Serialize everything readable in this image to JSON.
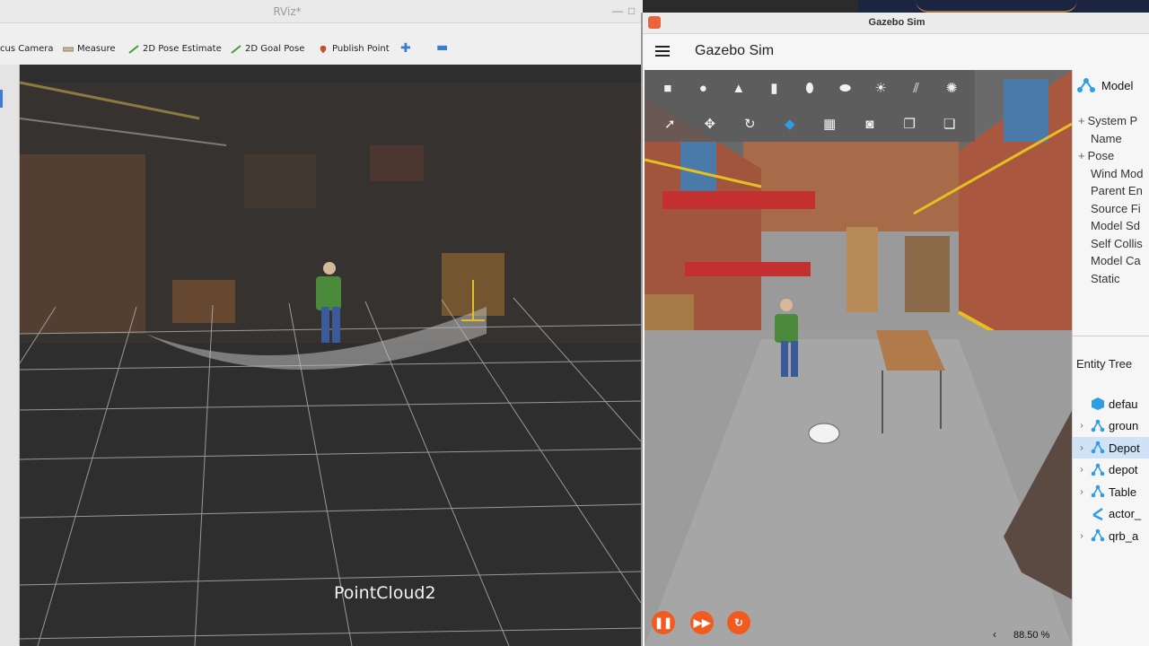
{
  "rviz": {
    "title": "RViz*",
    "toolbar": {
      "focus_camera": "cus Camera",
      "measure": "Measure",
      "pose_estimate": "2D Pose Estimate",
      "goal_pose": "2D Goal Pose",
      "publish_point": "Publish Point"
    },
    "view_label": "PointCloud2"
  },
  "gazebo": {
    "window_title": "Gazebo Sim",
    "app_title": "Gazebo Sim",
    "component": {
      "header": "Model",
      "rows": [
        {
          "label": "System P",
          "expandable": true
        },
        {
          "label": "Name",
          "expandable": false
        },
        {
          "label": "Pose",
          "expandable": true
        },
        {
          "label": "Wind Mod",
          "expandable": false
        },
        {
          "label": "Parent En",
          "expandable": false
        },
        {
          "label": "Source Fi",
          "expandable": false
        },
        {
          "label": "Model Sd",
          "expandable": false
        },
        {
          "label": "Self Collis",
          "expandable": false
        },
        {
          "label": "Model Ca",
          "expandable": false
        },
        {
          "label": "Static",
          "expandable": false
        }
      ]
    },
    "entity_tree": {
      "header": "Entity Tree",
      "items": [
        {
          "label": "defau",
          "icon": "cube-icon",
          "selected": false,
          "expandable": false
        },
        {
          "label": "groun",
          "icon": "model-icon",
          "selected": false,
          "expandable": true
        },
        {
          "label": "Depot",
          "icon": "model-icon",
          "selected": true,
          "expandable": true
        },
        {
          "label": "depot",
          "icon": "model-icon",
          "selected": false,
          "expandable": true
        },
        {
          "label": "Table",
          "icon": "model-icon",
          "selected": false,
          "expandable": true
        },
        {
          "label": "actor_",
          "icon": "actor-icon",
          "selected": false,
          "expandable": false
        },
        {
          "label": "qrb_a",
          "icon": "model-icon",
          "selected": false,
          "expandable": true
        }
      ]
    },
    "rtf": "88.50 %",
    "colors": {
      "accent": "#f25a1f",
      "selection": "#cfe2f6",
      "icon_blue": "#2f9ee0"
    }
  }
}
